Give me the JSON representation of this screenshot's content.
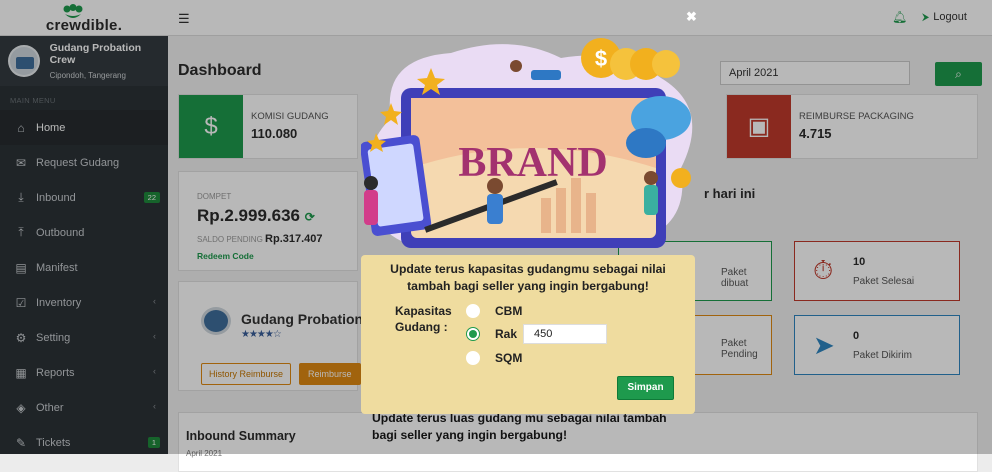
{
  "topbar": {
    "logo_text": "crewdible.",
    "logout_label": "Logout"
  },
  "sidebar": {
    "profile_name": "Gudang Probation Crew",
    "profile_location": "Cipondoh, Tangerang",
    "menu_header": "MAIN MENU",
    "items": [
      {
        "label": "Home"
      },
      {
        "label": "Request Gudang"
      },
      {
        "label": "Inbound",
        "badge": "22"
      },
      {
        "label": "Outbound"
      },
      {
        "label": "Manifest"
      },
      {
        "label": "Inventory"
      },
      {
        "label": "Setting"
      },
      {
        "label": "Reports"
      },
      {
        "label": "Other"
      },
      {
        "label": "Tickets",
        "badge": "1"
      }
    ]
  },
  "dashboard": {
    "title": "Dashboard",
    "month": "April 2021",
    "komisi_label": "KOMISI GUDANG",
    "komisi_value": "110.080",
    "reimburse_label": "REIMBURSE PACKAGING",
    "reimburse_value": "4.715",
    "dompet_label": "DOMPET",
    "dompet_value": "Rp.2.999.636",
    "saldo_label": "SALDO PENDING",
    "saldo_value": "Rp.317.407",
    "redeem_label": "Redeem Code",
    "gudang_name": "Gudang Probation",
    "btn_history": "History Reimburse",
    "btn_reimburse": "Reimburse",
    "per_hari_ini": "r hari ini",
    "paket_dibuat": "Paket dibuat",
    "paket_selesai_num": "10",
    "paket_selesai": "Paket Selesai",
    "paket_pending": "Paket Pending",
    "paket_dikirim_num": "0",
    "paket_dikirim": "Paket Dikirim",
    "inbound_summary": "Inbound Summary",
    "inbound_month": "April 2021"
  },
  "modal": {
    "banner_word": "BRAND",
    "message_line1": "Update terus kapasitas gudangmu sebagai nilai",
    "message_line2": "tambah bagi seller yang ingin bergabung!",
    "kapasitas_line1": "Kapasitas",
    "kapasitas_line2": "Gudang :",
    "options": [
      {
        "label": "CBM",
        "selected": false
      },
      {
        "label": "Rak",
        "selected": true
      },
      {
        "label": "SQM",
        "selected": false
      }
    ],
    "rak_value": "450",
    "submit_label": "Simpan"
  },
  "behind_text": {
    "line1": "Update terus luas gudang mu sebagai nilai tambah",
    "line2": "bagi seller yang ingin bergabung!"
  },
  "colors": {
    "brand_green": "#1e9a4d",
    "reimburse_red": "#c0392b",
    "orange": "#e08a12"
  }
}
